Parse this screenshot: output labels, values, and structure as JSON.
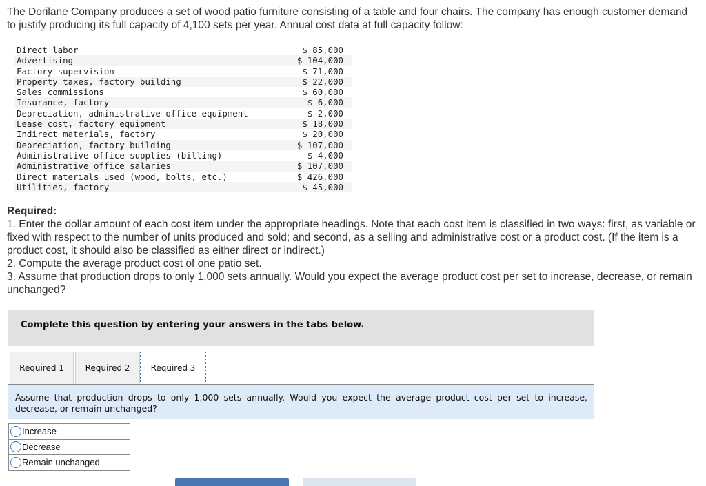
{
  "intro": "The Dorilane Company produces a set of wood patio furniture consisting of a table and four chairs. The company has enough customer demand to justify producing its full capacity of 4,100 sets per year. Annual cost data at full capacity follow:",
  "cost_items": [
    {
      "label": "Direct labor",
      "amount": "$ 85,000"
    },
    {
      "label": "Advertising",
      "amount": "$ 104,000"
    },
    {
      "label": "Factory supervision",
      "amount": "$ 71,000"
    },
    {
      "label": "Property taxes, factory building",
      "amount": "$ 22,000"
    },
    {
      "label": "Sales commissions",
      "amount": "$ 60,000"
    },
    {
      "label": "Insurance, factory",
      "amount": "$ 6,000"
    },
    {
      "label": "Depreciation, administrative office equipment",
      "amount": "$ 2,000"
    },
    {
      "label": "Lease cost, factory equipment",
      "amount": "$ 18,000"
    },
    {
      "label": "Indirect materials, factory",
      "amount": "$ 20,000"
    },
    {
      "label": "Depreciation, factory building",
      "amount": "$ 107,000"
    },
    {
      "label": "Administrative office supplies (billing)",
      "amount": "$ 4,000"
    },
    {
      "label": "Administrative office salaries",
      "amount": "$ 107,000"
    },
    {
      "label": "Direct materials used (wood, bolts, etc.)",
      "amount": "$ 426,000"
    },
    {
      "label": "Utilities, factory",
      "amount": "$ 45,000"
    }
  ],
  "required": {
    "heading": "Required:",
    "items": [
      "1. Enter the dollar amount of each cost item under the appropriate headings. Note that each cost item is classified in two ways: first, as variable or fixed with respect to the number of units produced and sold; and second, as a selling and administrative cost or a product cost. (If the item is a product cost, it should also be classified as either direct or indirect.)",
      "2. Compute the average product cost of one patio set.",
      "3. Assume that production drops to only 1,000 sets annually. Would you expect the average product cost per set to increase, decrease, or remain unchanged?"
    ]
  },
  "banner": "Complete this question by entering your answers in the tabs below.",
  "tabs": [
    {
      "label": "Required 1",
      "active": false
    },
    {
      "label": "Required 2",
      "active": false
    },
    {
      "label": "Required 3",
      "active": true
    }
  ],
  "question": "Assume that production drops to only 1,000 sets annually. Would you expect the average product cost per set to increase, decrease, or remain unchanged?",
  "options": [
    {
      "label": "Increase",
      "selected": false
    },
    {
      "label": "Decrease",
      "selected": false
    },
    {
      "label": "Remain unchanged",
      "selected": false
    }
  ],
  "colors": {
    "banner_bg": "#e1e1e1",
    "question_bg": "#ddebf8",
    "radio_border": "#3b78c0",
    "active_tab_border": "#3a6db5",
    "prev_button": "#4a76b3",
    "next_button": "#dce6f1"
  }
}
